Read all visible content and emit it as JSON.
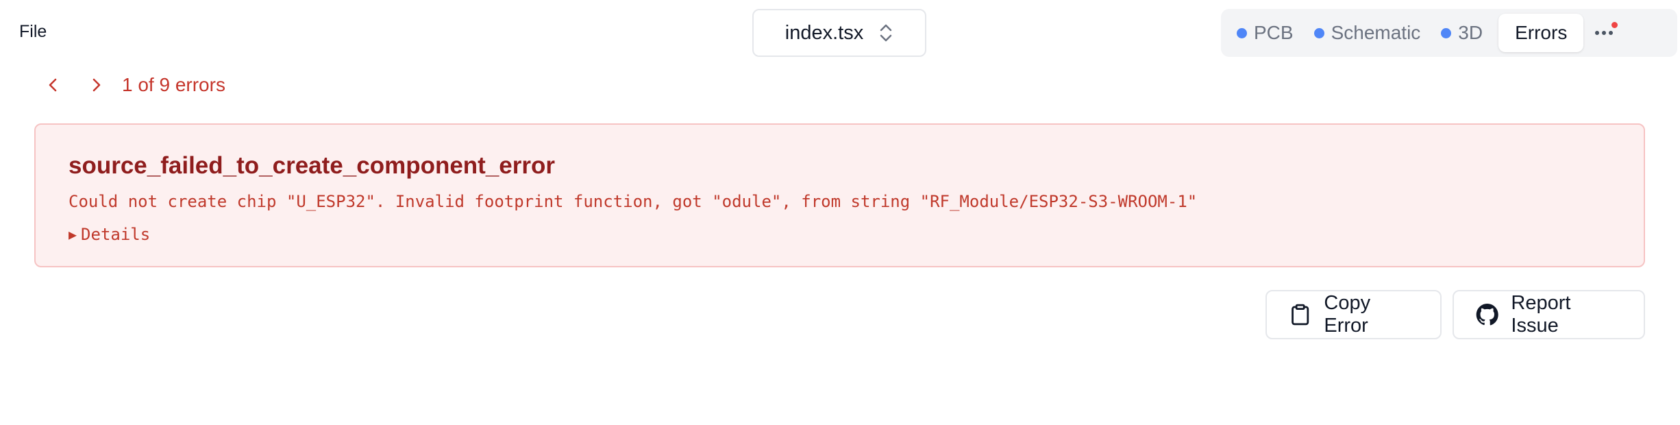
{
  "menu": {
    "file_label": "File"
  },
  "file_selector": {
    "value": "index.tsx",
    "icon": "chevrons-up-down-icon"
  },
  "view_tabs": [
    {
      "label": "PCB",
      "active": false
    },
    {
      "label": "Schematic",
      "active": false
    },
    {
      "label": "3D",
      "active": false
    },
    {
      "label": "Errors",
      "active": true
    }
  ],
  "tab_dot_color": "#4f86f7",
  "notification_color": "#ef4444",
  "pager": {
    "status": "1 of 9 errors"
  },
  "error": {
    "type": "source_failed_to_create_component_error",
    "message": "Could not create chip \"U_ESP32\". Invalid footprint function, got \"odule\", from string \"RF_Module/ESP32-S3-WROOM-1\"",
    "details_label": "Details"
  },
  "actions": {
    "copy_label": "Copy Error",
    "report_label": "Report Issue"
  },
  "accent_color": "#c5352b"
}
